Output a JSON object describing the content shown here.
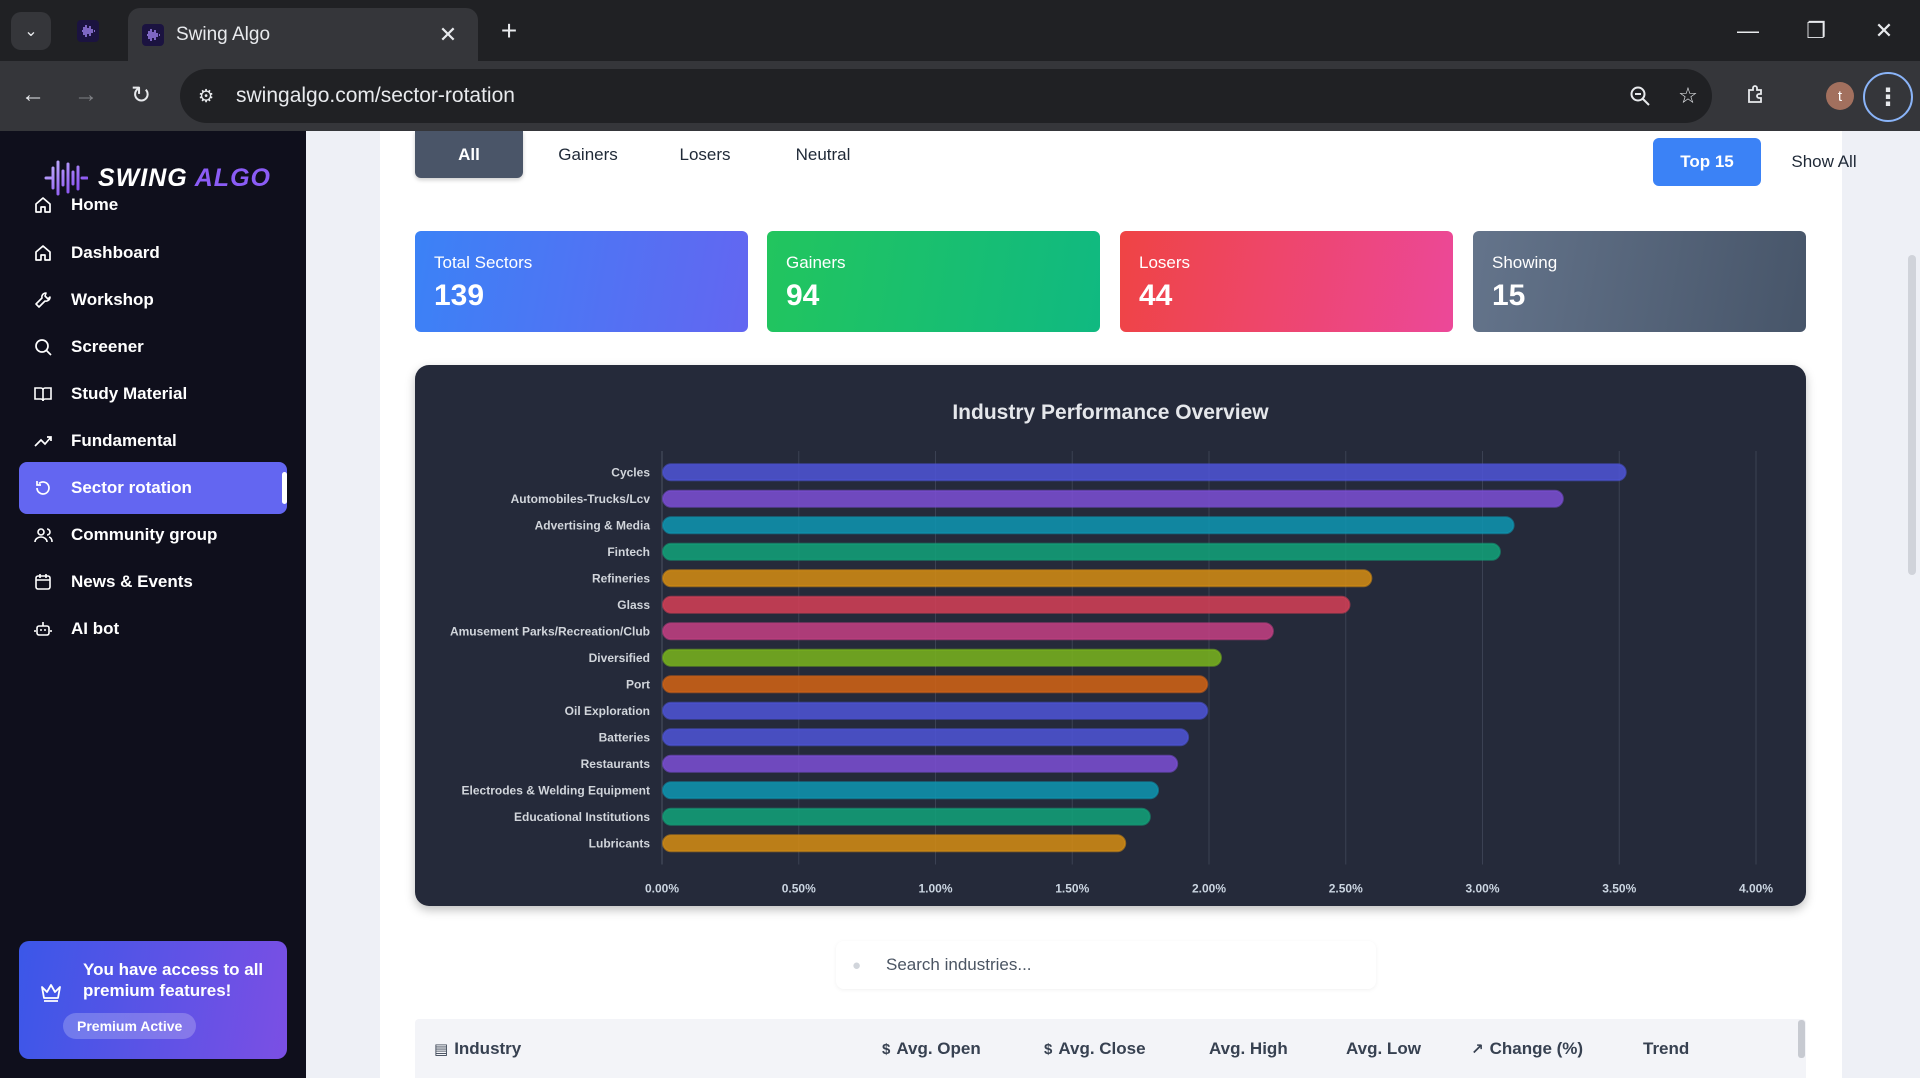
{
  "browser": {
    "tab_title": "Swing Algo",
    "url": "swingalgo.com/sector-rotation",
    "profile_initial": "t"
  },
  "sidebar": {
    "logo": {
      "word1": "SWING",
      "word2": "ALGO"
    },
    "items": [
      {
        "label": "Home",
        "icon": "home-icon"
      },
      {
        "label": "Dashboard",
        "icon": "home-icon"
      },
      {
        "label": "Workshop",
        "icon": "wrench-icon"
      },
      {
        "label": "Screener",
        "icon": "search-icon"
      },
      {
        "label": "Study Material",
        "icon": "book-icon"
      },
      {
        "label": "Fundamental",
        "icon": "trending-up-icon"
      },
      {
        "label": "Sector rotation",
        "icon": "rotate-icon",
        "active": true
      },
      {
        "label": "Community group",
        "icon": "users-icon"
      },
      {
        "label": "News & Events",
        "icon": "calendar-icon"
      },
      {
        "label": "AI bot",
        "icon": "bot-icon"
      }
    ],
    "premium": {
      "text": "You have access to all premium features!",
      "badge": "Premium Active"
    }
  },
  "filters": {
    "tabs": [
      "All",
      "Gainers",
      "Losers",
      "Neutral"
    ],
    "active_tab": "All",
    "limit_buttons": [
      "Top 15",
      "Show All"
    ],
    "active_limit": "Top 15"
  },
  "stats": [
    {
      "label": "Total Sectors",
      "value": "139",
      "gradient": [
        "#3b82f6",
        "#6366f1"
      ]
    },
    {
      "label": "Gainers",
      "value": "94",
      "gradient": [
        "#22c55e",
        "#10b981"
      ]
    },
    {
      "label": "Losers",
      "value": "44",
      "gradient": [
        "#ef4444",
        "#ec4899"
      ]
    },
    {
      "label": "Showing",
      "value": "15",
      "gradient": [
        "#64748b",
        "#475569"
      ]
    }
  ],
  "chart_data": {
    "type": "bar",
    "orientation": "horizontal",
    "title": "Industry Performance Overview",
    "categories": [
      "Cycles",
      "Automobiles-Trucks/Lcv",
      "Advertising & Media",
      "Fintech",
      "Refineries",
      "Glass",
      "Amusement Parks/Recreation/Club",
      "Diversified",
      "Port",
      "Oil Exploration",
      "Batteries",
      "Restaurants",
      "Electrodes & Welding Equipment",
      "Educational Institutions",
      "Lubricants"
    ],
    "values": [
      3.52,
      3.29,
      3.11,
      3.06,
      2.59,
      2.51,
      2.23,
      2.04,
      1.99,
      1.99,
      1.92,
      1.88,
      1.81,
      1.78,
      1.69
    ],
    "xlim": [
      0,
      4
    ],
    "xticks": [
      "0.00%",
      "0.50%",
      "1.00%",
      "1.50%",
      "2.00%",
      "2.50%",
      "3.00%",
      "3.50%",
      "4.00%"
    ],
    "grid": true,
    "colors": [
      "#4f55d8",
      "#7c4fd6",
      "#0e97b3",
      "#12a37a",
      "#d68d13",
      "#d63f57",
      "#c53f84",
      "#7ab51d",
      "#d56414",
      "#4f55d8",
      "#4f55d8",
      "#7c4fd6",
      "#0e97b3",
      "#12a37a",
      "#d68d13"
    ]
  },
  "search": {
    "placeholder": "Search industries..."
  },
  "table": {
    "headers": [
      {
        "label": "Industry",
        "icon": "building-icon"
      },
      {
        "label": "Avg. Open",
        "icon": "dollar-icon"
      },
      {
        "label": "Avg. Close",
        "icon": "dollar-icon"
      },
      {
        "label": "Avg. High",
        "icon": ""
      },
      {
        "label": "Avg. Low",
        "icon": ""
      },
      {
        "label": "Change (%)",
        "icon": "trending-up-icon"
      },
      {
        "label": "Trend",
        "icon": ""
      }
    ]
  }
}
